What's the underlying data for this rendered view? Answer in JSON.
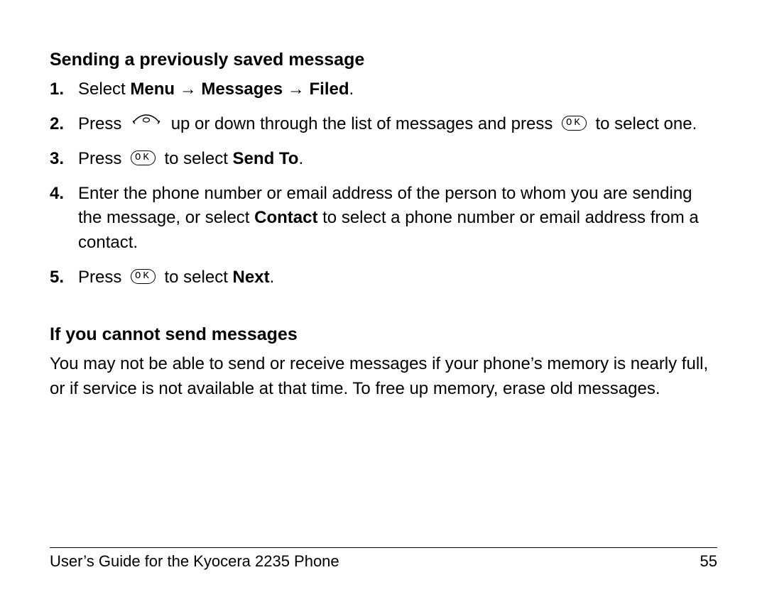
{
  "headings": {
    "h1": "Sending a previously saved message",
    "h2": "If you cannot send messages"
  },
  "steps": {
    "s1": {
      "num": "1.",
      "a": "Select ",
      "b": "Menu",
      "c": " → ",
      "d": "Messages",
      "e": " → ",
      "f": "Filed",
      "g": "."
    },
    "s2": {
      "num": "2.",
      "a": "Press ",
      "b": " up or down through the list of messages and press ",
      "c": " to select one."
    },
    "s3": {
      "num": "3.",
      "a": "Press ",
      "b": " to select ",
      "c": "Send To",
      "d": "."
    },
    "s4": {
      "num": "4.",
      "a": "Enter the phone number or email address of the person to whom you are sending the message, or select ",
      "b": "Contact",
      "c": " to select a phone number or email address from a contact."
    },
    "s5": {
      "num": "5.",
      "a": "Press ",
      "b": " to select ",
      "c": "Next",
      "d": "."
    }
  },
  "paragraph": "You may not be able to send or receive messages if your phone’s memory is nearly full, or if service is not available at that time. To free up memory, erase old messages.",
  "icons": {
    "ok_label": "OK"
  },
  "footer": {
    "title": "User’s Guide for the Kyocera 2235 Phone",
    "page": "55"
  }
}
